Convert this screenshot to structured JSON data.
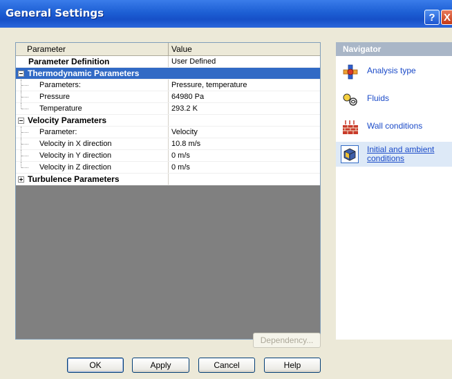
{
  "window": {
    "title": "General Settings",
    "help_glyph": "?",
    "close_glyph": "X"
  },
  "grid": {
    "columns": [
      "Parameter",
      "Value"
    ],
    "rows": [
      {
        "parameter": "Parameter Definition",
        "value": "User Defined"
      },
      {
        "parameter": "Thermodynamic Parameters",
        "value": ""
      },
      {
        "parameter": "Parameters:",
        "value": "Pressure, temperature"
      },
      {
        "parameter": "Pressure",
        "value": "64980 Pa"
      },
      {
        "parameter": "Temperature",
        "value": "293.2 K"
      },
      {
        "parameter": "Velocity Parameters",
        "value": ""
      },
      {
        "parameter": "Parameter:",
        "value": "Velocity"
      },
      {
        "parameter": "Velocity in X direction",
        "value": "10.8 m/s"
      },
      {
        "parameter": "Velocity in Y direction",
        "value": "0 m/s"
      },
      {
        "parameter": "Velocity in Z direction",
        "value": "0 m/s"
      },
      {
        "parameter": "Turbulence Parameters",
        "value": ""
      }
    ]
  },
  "buttons": {
    "dependency": "Dependency...",
    "ok": "OK",
    "apply": "Apply",
    "cancel": "Cancel",
    "help": "Help"
  },
  "navigator": {
    "header": "Navigator",
    "items": [
      {
        "label": "Analysis type",
        "icon": "analysis-type-icon"
      },
      {
        "label": "Fluids",
        "icon": "fluids-icon"
      },
      {
        "label": "Wall conditions",
        "icon": "wall-conditions-icon"
      },
      {
        "label_line1": "Initial and ambient",
        "label_line2": "conditions",
        "icon": "initial-conditions-icon"
      }
    ]
  },
  "colors": {
    "title_bar": "#1d5fd4",
    "selection": "#316ac5",
    "link": "#1a4ac8",
    "dialog_bg": "#ece9d8"
  }
}
